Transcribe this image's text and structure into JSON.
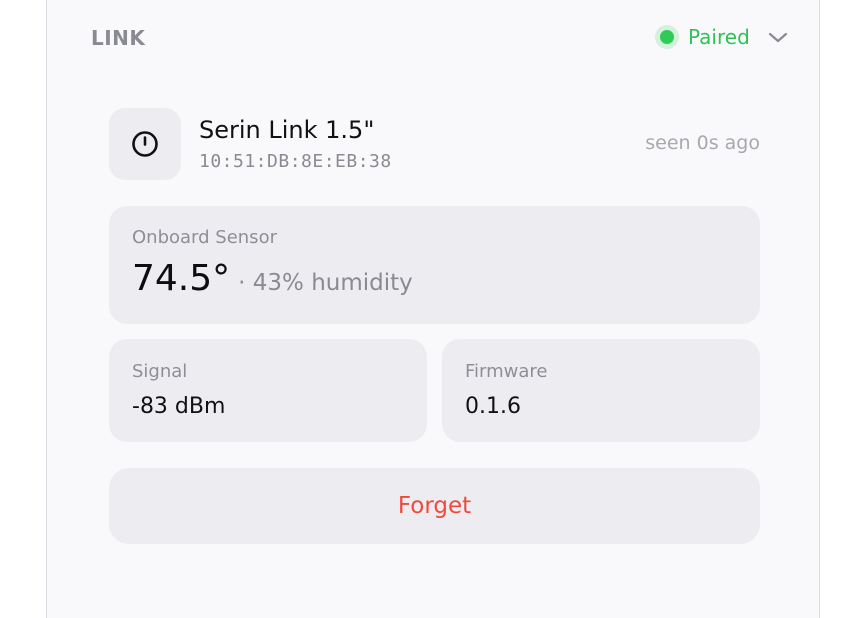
{
  "section": {
    "label": "LINK"
  },
  "status": {
    "text": "Paired",
    "color": "#2ecb56",
    "icon": "chevron-down-icon"
  },
  "device": {
    "icon": "power-icon",
    "name": "Serin Link 1.5\"",
    "mac": "10:51:DB:8E:EB:38",
    "seen": "seen 0s ago"
  },
  "sensor": {
    "label": "Onboard Sensor",
    "temperature": "74.5°",
    "humidity": "· 43% humidity"
  },
  "signal": {
    "label": "Signal",
    "value": "-83 dBm"
  },
  "firmware": {
    "label": "Firmware",
    "value": "0.1.6"
  },
  "actions": {
    "forget_label": "Forget",
    "forget_color": "#f04a3c"
  }
}
